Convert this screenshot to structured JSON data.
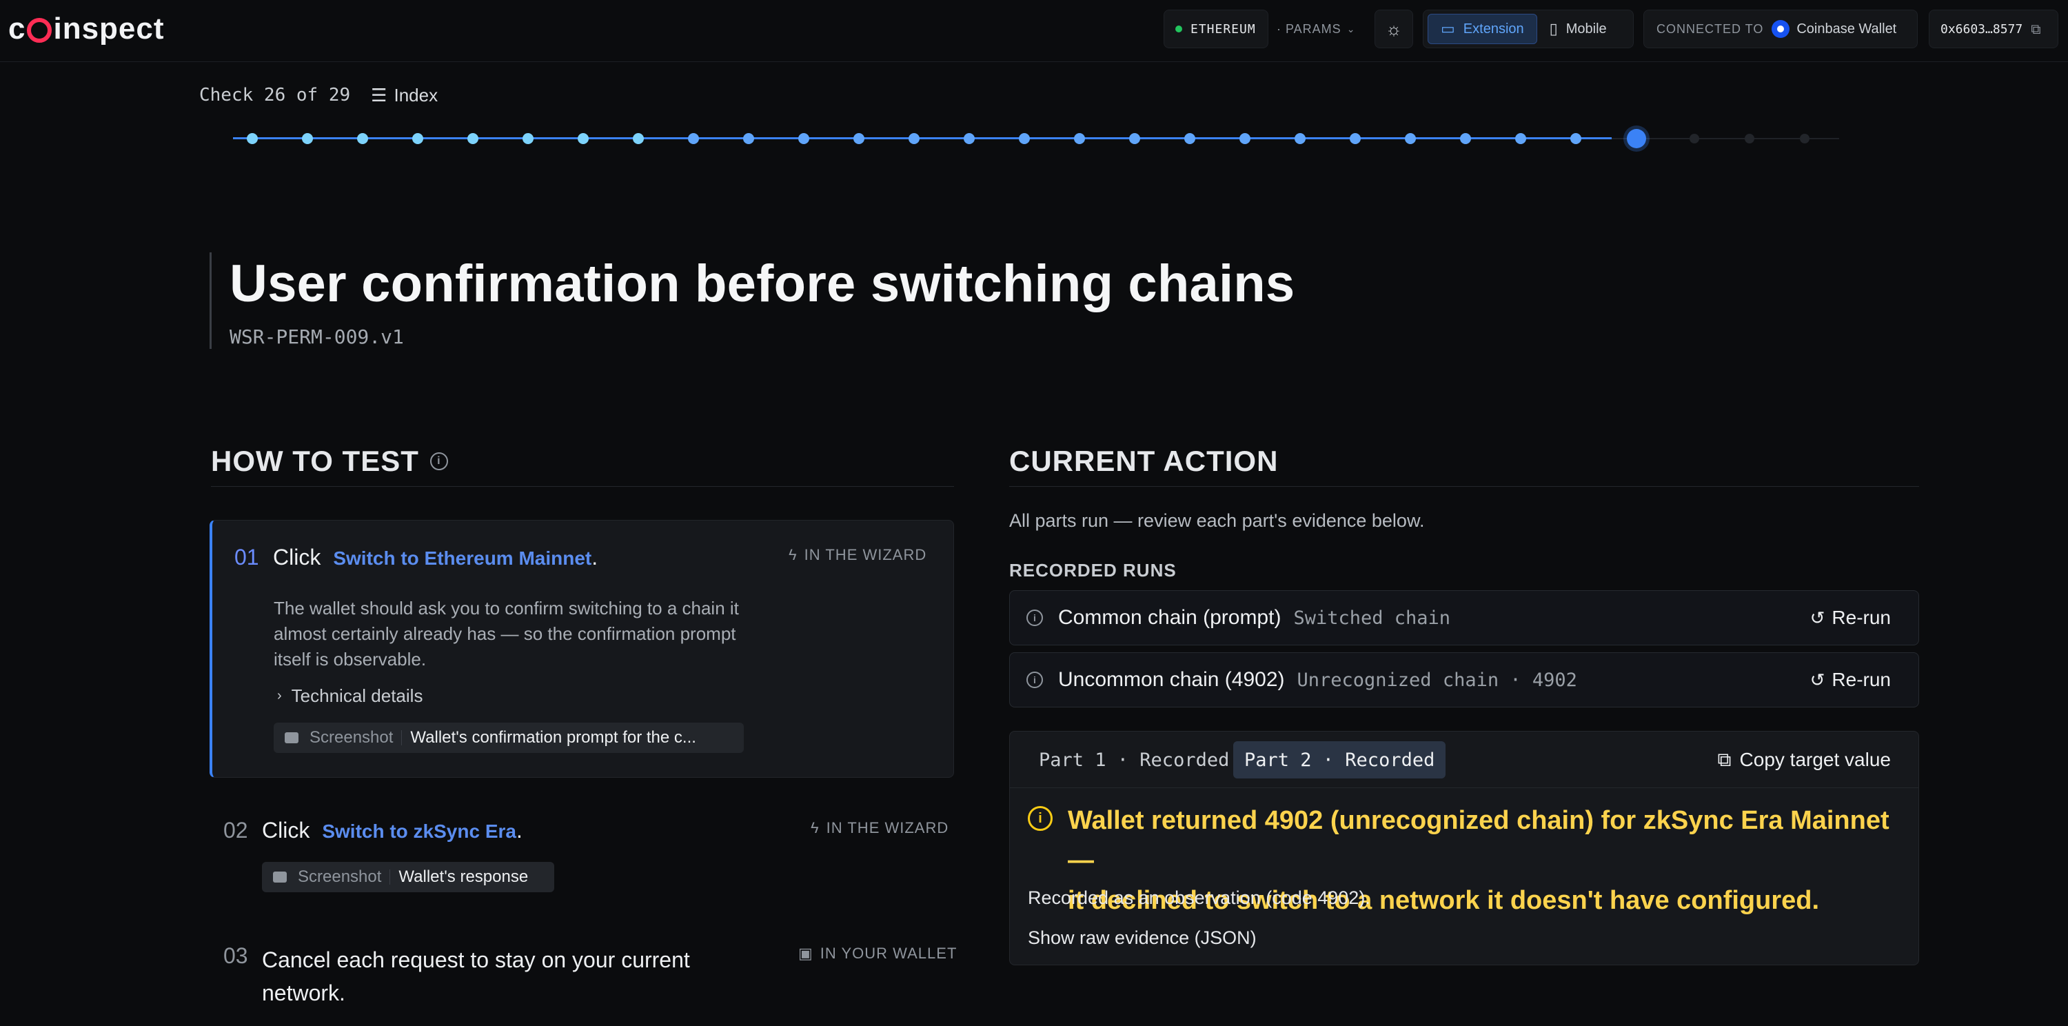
{
  "header": {
    "logo_left": "c",
    "logo_right": "inspect",
    "network": "ETHEREUM",
    "params": "· PARAMS",
    "mode_extension": "Extension",
    "mode_mobile": "Mobile",
    "connected_label": "CONNECTED TO",
    "wallet_name": "Coinbase Wallet",
    "address": "0x6603…8577"
  },
  "progress": {
    "counter": "Check 26 of 29",
    "index_label": "Index",
    "total": 29,
    "current": 26
  },
  "check": {
    "title": "User confirmation before switching chains",
    "id": "WSR-PERM-009.v1"
  },
  "how_to_test": {
    "heading": "HOW TO TEST",
    "steps": [
      {
        "num": "01",
        "verb": "Click",
        "link": "Switch to Ethereum Mainnet",
        "period": ".",
        "tag": "IN THE WIZARD",
        "description": "The wallet should ask you to confirm switching to a chain it almost certainly already has — so the confirmation prompt itself is observable.",
        "details_label": "Technical details",
        "chip_key": "Screenshot",
        "chip_value": "Wallet's confirmation prompt for the c..."
      },
      {
        "num": "02",
        "verb": "Click",
        "link": "Switch to zkSync Era",
        "period": ".",
        "tag": "IN THE WIZARD",
        "chip_key": "Screenshot",
        "chip_value": "Wallet's response"
      },
      {
        "num": "03",
        "text_line1": "Cancel each request to stay on your current",
        "text_line2": "network.",
        "tag": "IN YOUR WALLET"
      }
    ]
  },
  "current_action": {
    "heading": "CURRENT ACTION",
    "summary": "All parts run — review each part's evidence below.",
    "recorded_runs_label": "RECORDED RUNS",
    "runs": [
      {
        "name": "Common chain (prompt)",
        "status": "Switched chain",
        "action": "Re-run"
      },
      {
        "name": "Uncommon chain (4902)",
        "status": "Unrecognized chain · 4902",
        "action": "Re-run"
      }
    ],
    "evidence": {
      "tabs": [
        "Part 1 · Recorded",
        "Part 2 · Recorded"
      ],
      "active_tab": 1,
      "copy_label": "Copy target value",
      "warning_line1": "Wallet returned 4902 (unrecognized chain) for zkSync Era Mainnet —",
      "warning_line2": "it declined to switch to a network it doesn't have configured.",
      "note": "Recorded as an observation (code 4902).",
      "raw_label": "Show raw evidence (JSON)"
    }
  },
  "colors": {
    "accent": "#3b82f6",
    "warning": "#fcd34d",
    "connected_dot": "#22c55e"
  }
}
